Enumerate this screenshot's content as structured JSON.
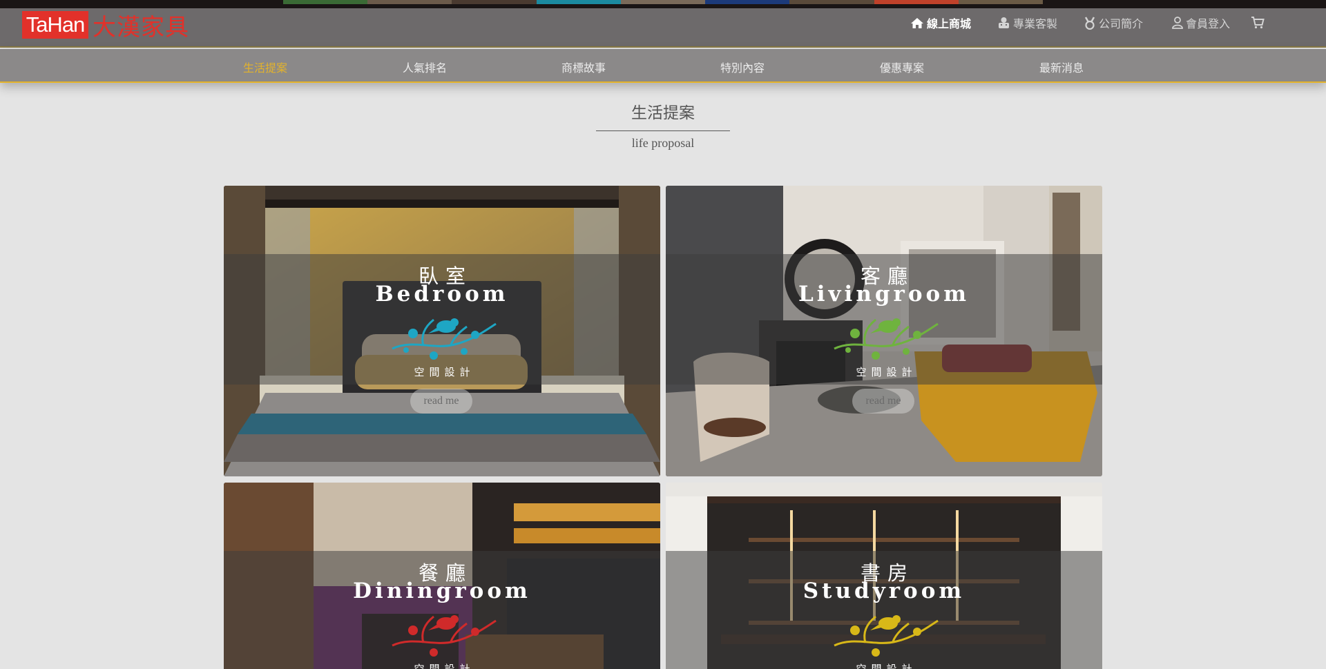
{
  "brand": {
    "logo_latin": "TaHan",
    "logo_chinese": "大漢家具",
    "brand_color": "#e2312a"
  },
  "top_nav": {
    "shop": {
      "label": "線上商城",
      "icon": "home-icon"
    },
    "custom": {
      "label": "專業客製",
      "icon": "robot-icon"
    },
    "about": {
      "label": "公司簡介",
      "icon": "medal-icon"
    },
    "login": {
      "label": "會員登入",
      "icon": "user-icon"
    },
    "cart": {
      "icon": "cart-icon"
    }
  },
  "sub_nav": [
    {
      "label": "生活提案",
      "active": true
    },
    {
      "label": "人氣排名",
      "active": false
    },
    {
      "label": "商標故事",
      "active": false
    },
    {
      "label": "特別內容",
      "active": false
    },
    {
      "label": "優惠專案",
      "active": false
    },
    {
      "label": "最新消息",
      "active": false
    }
  ],
  "section": {
    "title": "生活提案",
    "subtitle": "life proposal"
  },
  "cards": [
    {
      "cn": "臥室",
      "en": "Bedroom",
      "label": "空間設計",
      "button": "read me",
      "ornament_color": "#1ea6c4"
    },
    {
      "cn": "客廳",
      "en": "Livingroom",
      "label": "空間設計",
      "button": "read me",
      "ornament_color": "#6fb33e"
    },
    {
      "cn": "餐廳",
      "en": "Diningroom",
      "label": "空間設計",
      "ornament_color": "#d02a2a"
    },
    {
      "cn": "書房",
      "en": "Studyroom",
      "label": "空間設計",
      "ornament_color": "#d8b818"
    }
  ],
  "colors": {
    "accent": "#e4b32a",
    "header_bg": "#6d6a6b",
    "subnav_bg": "#8b8989",
    "page_bg": "#e4e4e4"
  }
}
